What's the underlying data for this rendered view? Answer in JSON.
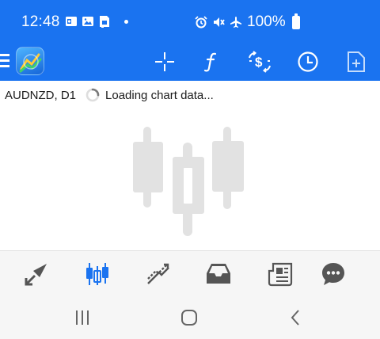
{
  "statusbar": {
    "time": "12:48",
    "battery": "100%",
    "left_icons": [
      "outlook-icon",
      "gallery-icon",
      "sim-card-icon",
      "dot-icon"
    ],
    "right_icons": [
      "alarm-icon",
      "mute-icon",
      "airplane-icon",
      "battery-icon"
    ]
  },
  "toolbar": {
    "icons": [
      "menu-icon",
      "app-logo",
      "crosshair-icon",
      "function-icon",
      "trade-icon",
      "clock-icon",
      "new-document-icon"
    ]
  },
  "chart": {
    "symbol": "AUDNZD, D1",
    "status": "Loading chart data..."
  },
  "bottom_nav": {
    "items": [
      "quotes-icon",
      "chart-icon",
      "trade-icon",
      "history-inbox-icon",
      "news-icon",
      "chat-icon"
    ],
    "active": "chart-icon"
  },
  "system_nav": {
    "items": [
      "recent-apps-button",
      "home-button",
      "back-button"
    ]
  },
  "colors": {
    "brand": "#1a73f0",
    "active_tab": "#1a73f0",
    "inactive_tab": "#555555",
    "placeholder": "#e2e2e2"
  }
}
